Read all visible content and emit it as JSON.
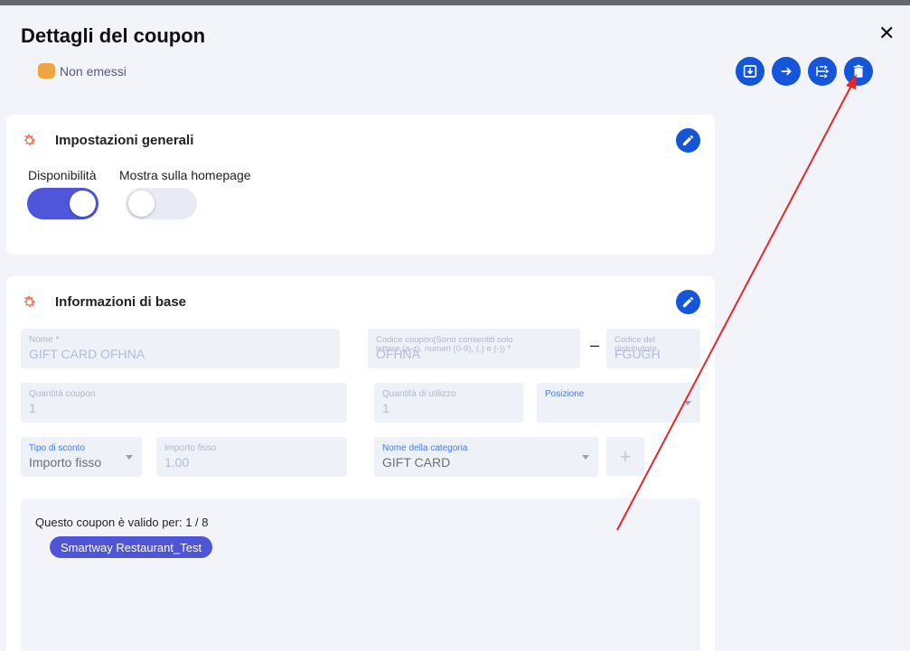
{
  "header": {
    "title": "Dettagli del coupon",
    "close_symbol": "✕",
    "status_label": "Non emessi",
    "status_color": "#f0a341"
  },
  "actions": [
    "download-icon",
    "arrow-right-icon",
    "split-icon",
    "trash-icon"
  ],
  "general": {
    "title": "Impostazioni generali",
    "availability_label": "Disponibilità",
    "availability_on": true,
    "homepage_label": "Mostra sulla homepage",
    "homepage_on": false
  },
  "basic": {
    "title": "Informazioni di base",
    "name_label": "Nome *",
    "name_value": "GIFT CARD OFHNA",
    "code_label": "Codice coupon(Sono consentiti solo lettere (a-z), numeri (0-9), (.) e (-)) *",
    "code_value": "OFHNA",
    "code_separator": "–",
    "distributor_label": "Codice del distributore",
    "distributor_value": "FGUGH",
    "quantity_label": "Quantità coupon",
    "quantity_value": "1",
    "usage_label": "Quantità di utilizzo",
    "usage_value": "1",
    "position_label": "Posizione",
    "position_value": "",
    "discount_type_label": "Tipo di sconto",
    "discount_type_value": "Importo fisso",
    "fixed_amount_label": "Importo fisso",
    "fixed_amount_value": "1.00",
    "category_label": "Nome della categoria",
    "category_value": "GIFT CARD",
    "add_symbol": "+"
  },
  "validity": {
    "text": "Questo coupon è valido per: 1 / 8",
    "chips": [
      "Smartway Restaurant_Test"
    ]
  },
  "colors": {
    "accent": "#1455d9",
    "toggle_on": "#5056d9",
    "annotation_arrow": "#e8262a"
  }
}
